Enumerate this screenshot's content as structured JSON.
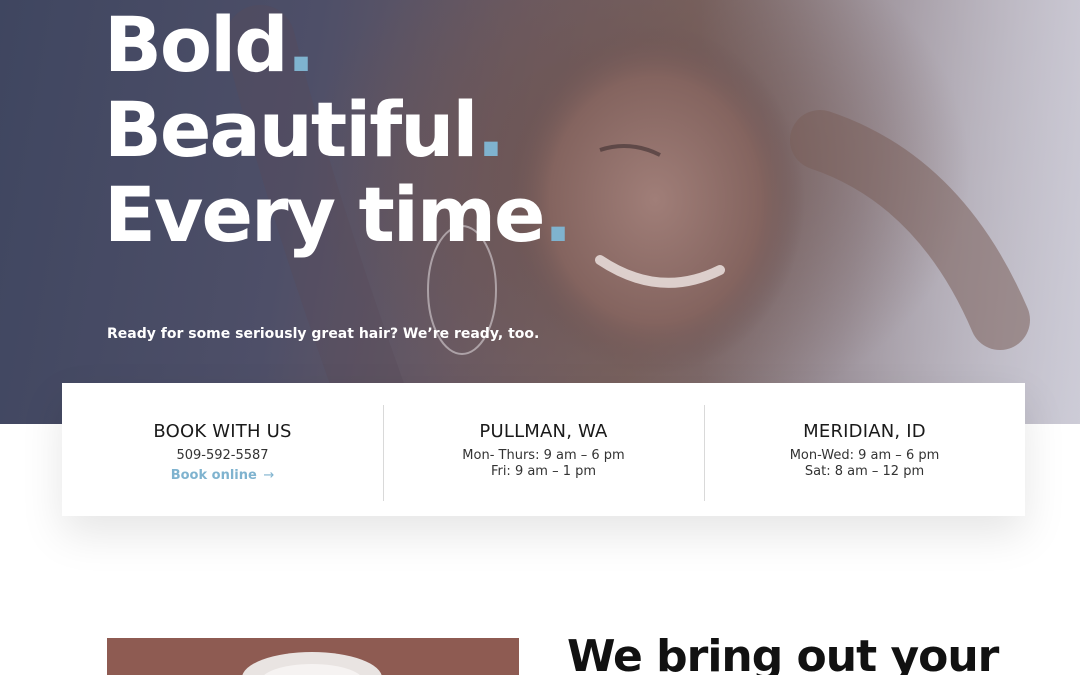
{
  "hero": {
    "eyebrow": "",
    "headline": [
      {
        "text": "Bold",
        "dot": "."
      },
      {
        "text": "Beautiful",
        "dot": "."
      },
      {
        "text": "Every time",
        "dot": "."
      }
    ],
    "tagline": "Ready for some seriously great hair? We’re ready, too."
  },
  "info": {
    "book": {
      "heading": "BOOK WITH US",
      "phone": "509-592-5587",
      "link": "Book online",
      "arrow": "→"
    },
    "pullman": {
      "heading": "PULLMAN, WA",
      "line1": "Mon- Thurs: 9 am – 6 pm",
      "line2": "Fri: 9 am – 1 pm"
    },
    "meridian": {
      "heading": "MERIDIAN, ID",
      "line1": "Mon-Wed: 9 am – 6 pm",
      "line2": "Sat: 8 am – 12 pm"
    }
  },
  "section": {
    "heading": "We bring out your"
  },
  "colors": {
    "accent": "#7fb3cf",
    "text_dark": "#1a1a1a",
    "hero_overlay": "#4a4d66"
  }
}
